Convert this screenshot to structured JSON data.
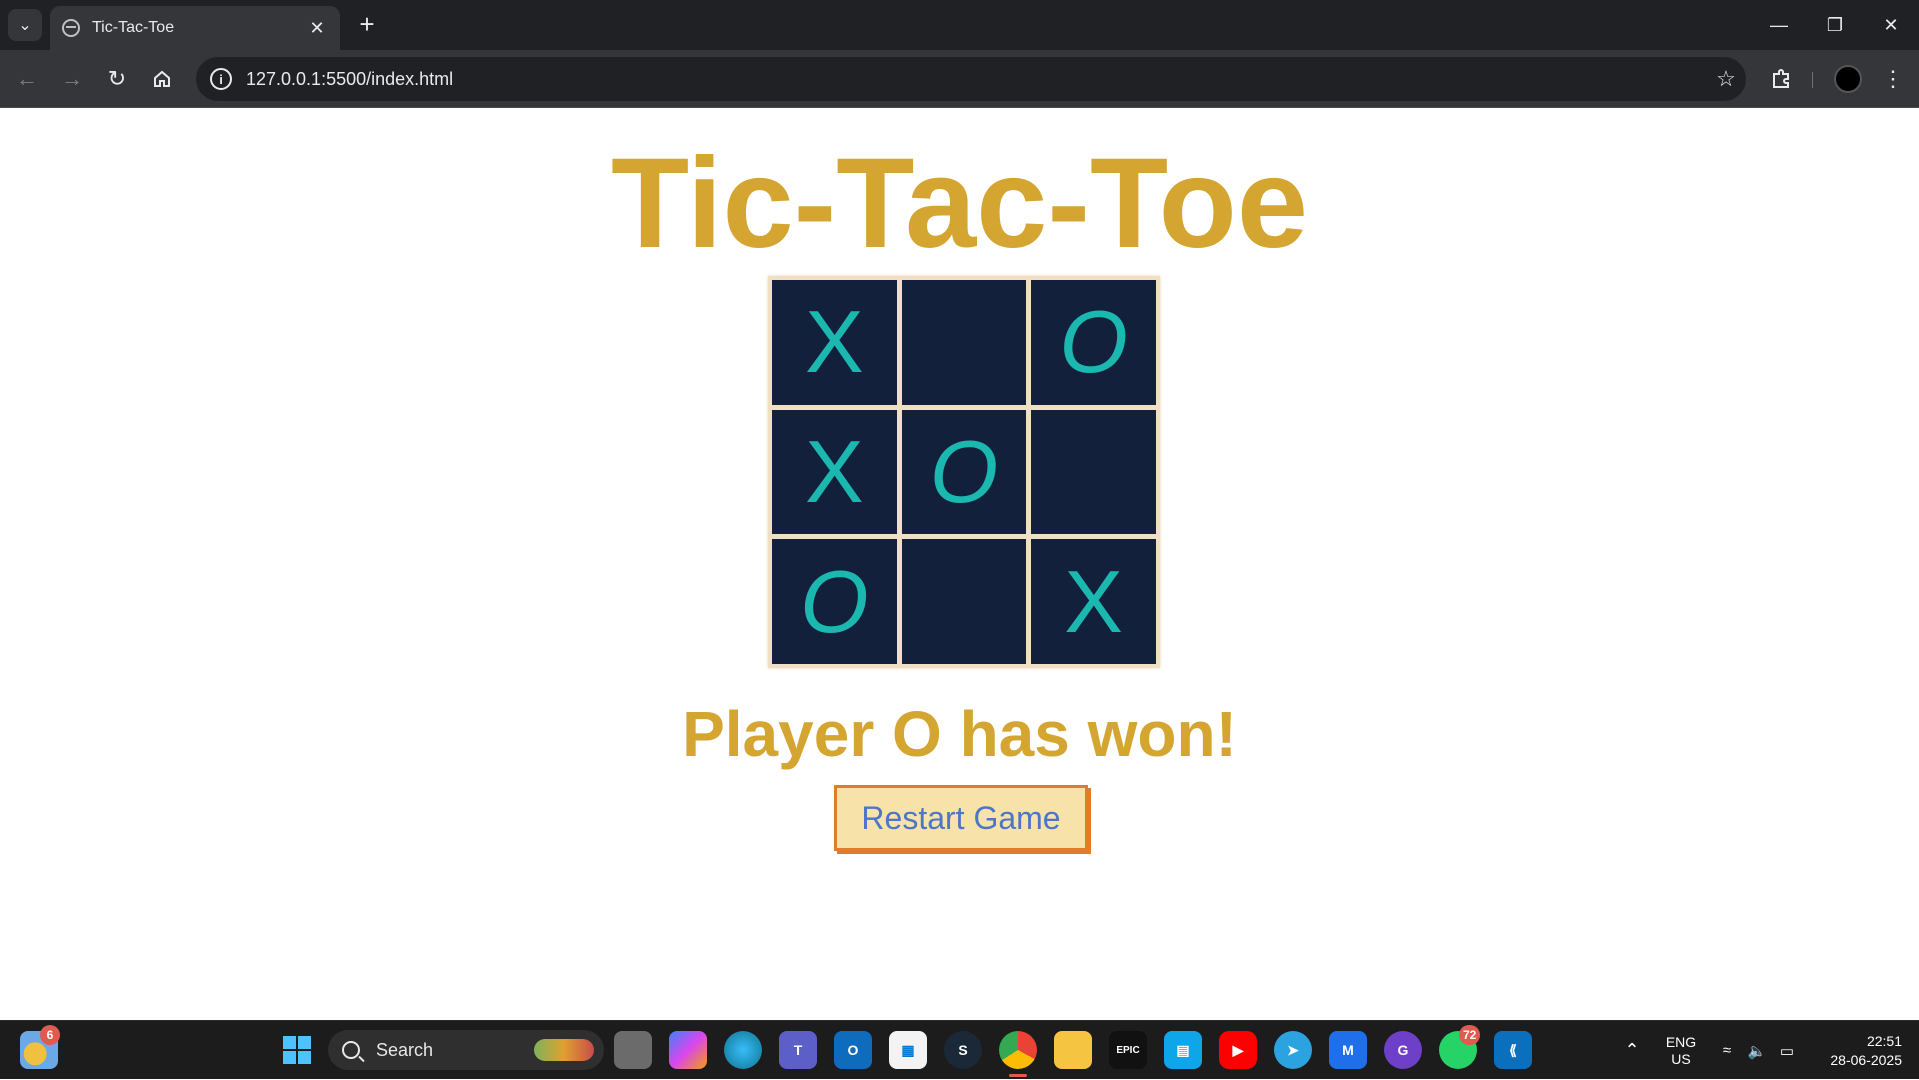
{
  "browser": {
    "tab_title": "Tic-Tac-Toe",
    "new_tab": "+",
    "url": "127.0.0.1:5500/index.html"
  },
  "page": {
    "title": "Tic-Tac-Toe",
    "board": [
      [
        "X",
        "",
        "O"
      ],
      [
        "X",
        "O",
        ""
      ],
      [
        "O",
        "",
        "X"
      ]
    ],
    "status": "Player O has won!",
    "restart_label": "Restart Game",
    "colors": {
      "title": "#d4a531",
      "cell_bg": "#13203c",
      "mark": "#1bb8b0",
      "board_border": "#f1dfc4",
      "button_bg": "#f7e2a9",
      "button_border": "#e27c2a",
      "button_text": "#4d76c9"
    }
  },
  "taskbar": {
    "weather_badge": "6",
    "search_placeholder": "Search",
    "whatsapp_badge": "72",
    "language": "ENG",
    "region": "US",
    "time": "22:51",
    "date": "28-06-2025"
  }
}
